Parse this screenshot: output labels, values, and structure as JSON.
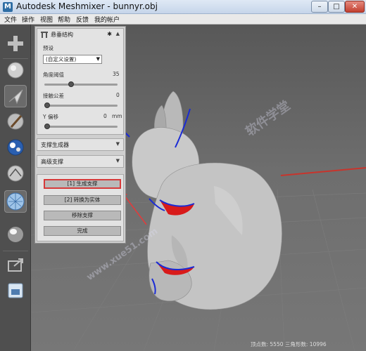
{
  "window": {
    "title": "Autodesk Meshmixer - bunnyr.obj",
    "app_icon_glyph": "M",
    "minimize_glyph": "–",
    "maximize_glyph": "□",
    "close_glyph": "✕"
  },
  "menu": [
    "文件",
    "操作",
    "视图",
    "帮助",
    "反馈",
    "我的帐户"
  ],
  "tools": [
    {
      "name": "add-icon"
    },
    {
      "name": "meshmix-icon"
    },
    {
      "name": "select-icon"
    },
    {
      "name": "sculpt-icon"
    },
    {
      "name": "stamp-icon"
    },
    {
      "name": "edit-icon"
    },
    {
      "name": "analysis-icon"
    },
    {
      "name": "shaders-icon"
    },
    {
      "name": "export-icon"
    },
    {
      "name": "print-icon"
    }
  ],
  "panel": {
    "header": {
      "title": "悬垂结构",
      "settings_glyph": "✱",
      "collapse_glyph": "▲"
    },
    "preset_label": "预设",
    "preset_value": "(自定义设置)",
    "angle_label": "角度阈值",
    "angle_value": "35",
    "angle_fraction": 0.35,
    "contact_label": "接触公差",
    "contact_value": "0",
    "contact_fraction": 0.0,
    "yoffset_label": "Y 偏移",
    "yoffset_value": "0",
    "yoffset_unit": "mm",
    "yoffset_fraction": 0.0,
    "generator": {
      "title": "支撑生成器",
      "arrow": "▼"
    },
    "advanced": {
      "title": "高级支撑",
      "arrow": "▼"
    },
    "buttons": {
      "generate": "[1] 生成支撑",
      "convert": "[2] 转换为实体",
      "remove": "移除支撑",
      "done": "完成"
    }
  },
  "status": {
    "text": "顶点数: 5550 三角形数: 10996"
  },
  "watermark": {
    "text": "软件学堂",
    "site": "www.xue51.com"
  },
  "colors": {
    "overhang_outline": "#1a2bd6",
    "overhang_fill": "#d81a1a",
    "floor_line": "#c8342c",
    "highlight_outline": "#d63a3a"
  }
}
